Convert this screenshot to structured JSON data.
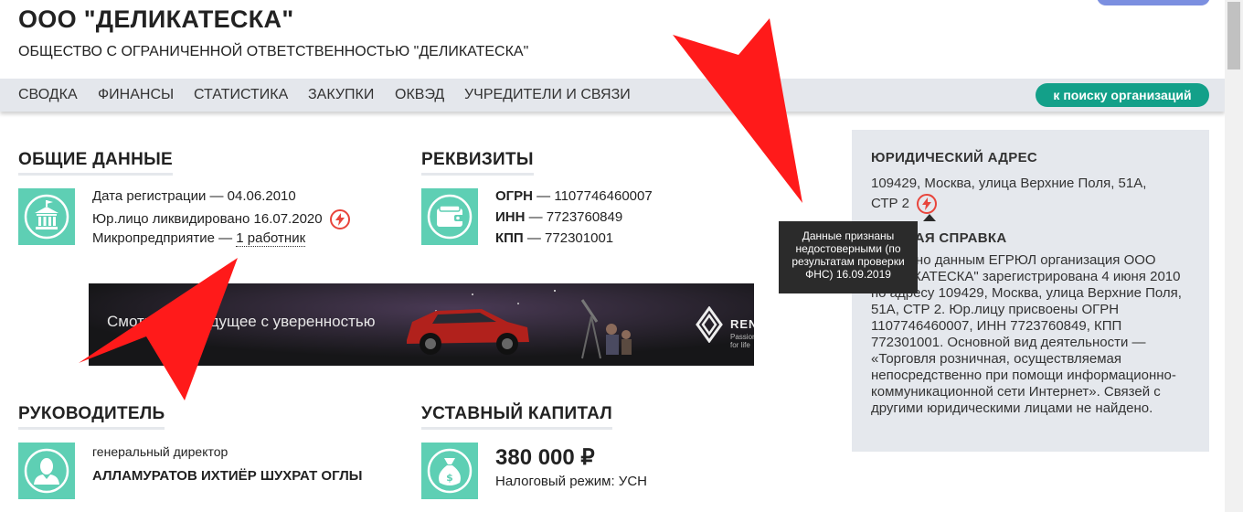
{
  "org": {
    "short_name": "ООО \"ДЕЛИКАТЕСКА\"",
    "full_name": "ОБЩЕСТВО С ОГРАНИЧЕННОЙ ОТВЕТСТВЕННОСТЬЮ \"ДЕЛИКАТЕСКА\""
  },
  "nav": {
    "items": [
      "СВОДКА",
      "ФИНАНСЫ",
      "СТАТИСТИКА",
      "ЗАКУПКИ",
      "ОКВЭД",
      "УЧРЕДИТЕЛИ И СВЯЗИ"
    ],
    "search_button": "к поиску организаций"
  },
  "general": {
    "heading": "ОБЩИЕ ДАННЫЕ",
    "registration": "Дата регистрации — 04.06.2010",
    "liquidated": "Юр.лицо ликвидировано 16.07.2020",
    "micro_prefix": "Микропредприятие — ",
    "micro_workers": "1 работник"
  },
  "requisites": {
    "heading": "РЕКВИЗИТЫ",
    "ogrn_label": "ОГРН",
    "ogrn_value": " — 1107746460007",
    "inn_label": "ИНН",
    "inn_value": " — 7723760849",
    "kpp_label": "КПП",
    "kpp_value": " — 772301001"
  },
  "banner": {
    "text": "Смотрите в будущее с уверенностью",
    "brand": "RENAULT",
    "tagline": "Passion for life"
  },
  "director": {
    "heading": "РУКОВОДИТЕЛЬ",
    "position": "генеральный директор",
    "name": "АЛЛАМУРАТОВ ИХТИЁР ШУХРАТ ОГЛЫ"
  },
  "capital": {
    "heading": "УСТАВНЫЙ КАПИТАЛ",
    "amount": "380 000 ₽",
    "tax_regime": "Налоговый режим: УСН"
  },
  "sidebar": {
    "address_heading": "ЮРИДИЧЕСКИЙ АДРЕС",
    "address_line1": "109429, Москва, улица Верхние Поля, 51А,",
    "address_line2": "СТР 2",
    "summary_heading": "КРАТКАЯ СПРАВКА",
    "summary_text": "Согласно данным ЕГРЮЛ организация ООО \"ДЕЛИКАТЕСКА\" зарегистрирована 4 июня 2010 по адресу 109429, Москва, улица Верхние Поля, 51А, СТР 2. Юр.лицу присвоены ОГРН 1107746460007, ИНН 7723760849, КПП 772301001. Основной вид деятельности — «Торговля розничная, осуществляемая непосредственно при помощи информационно-коммуникационной сети Интернет». Связей с другими юридическими лицами не найдено."
  },
  "tooltip": {
    "text": "Данные признаны недостоверными (по результатам проверки ФНС) 16.09.2019"
  },
  "colors": {
    "accent_green": "#13a089",
    "icon_teal": "#5ecfb4",
    "warning_red": "#e8453c",
    "arrow_red": "#ff1a1a"
  }
}
